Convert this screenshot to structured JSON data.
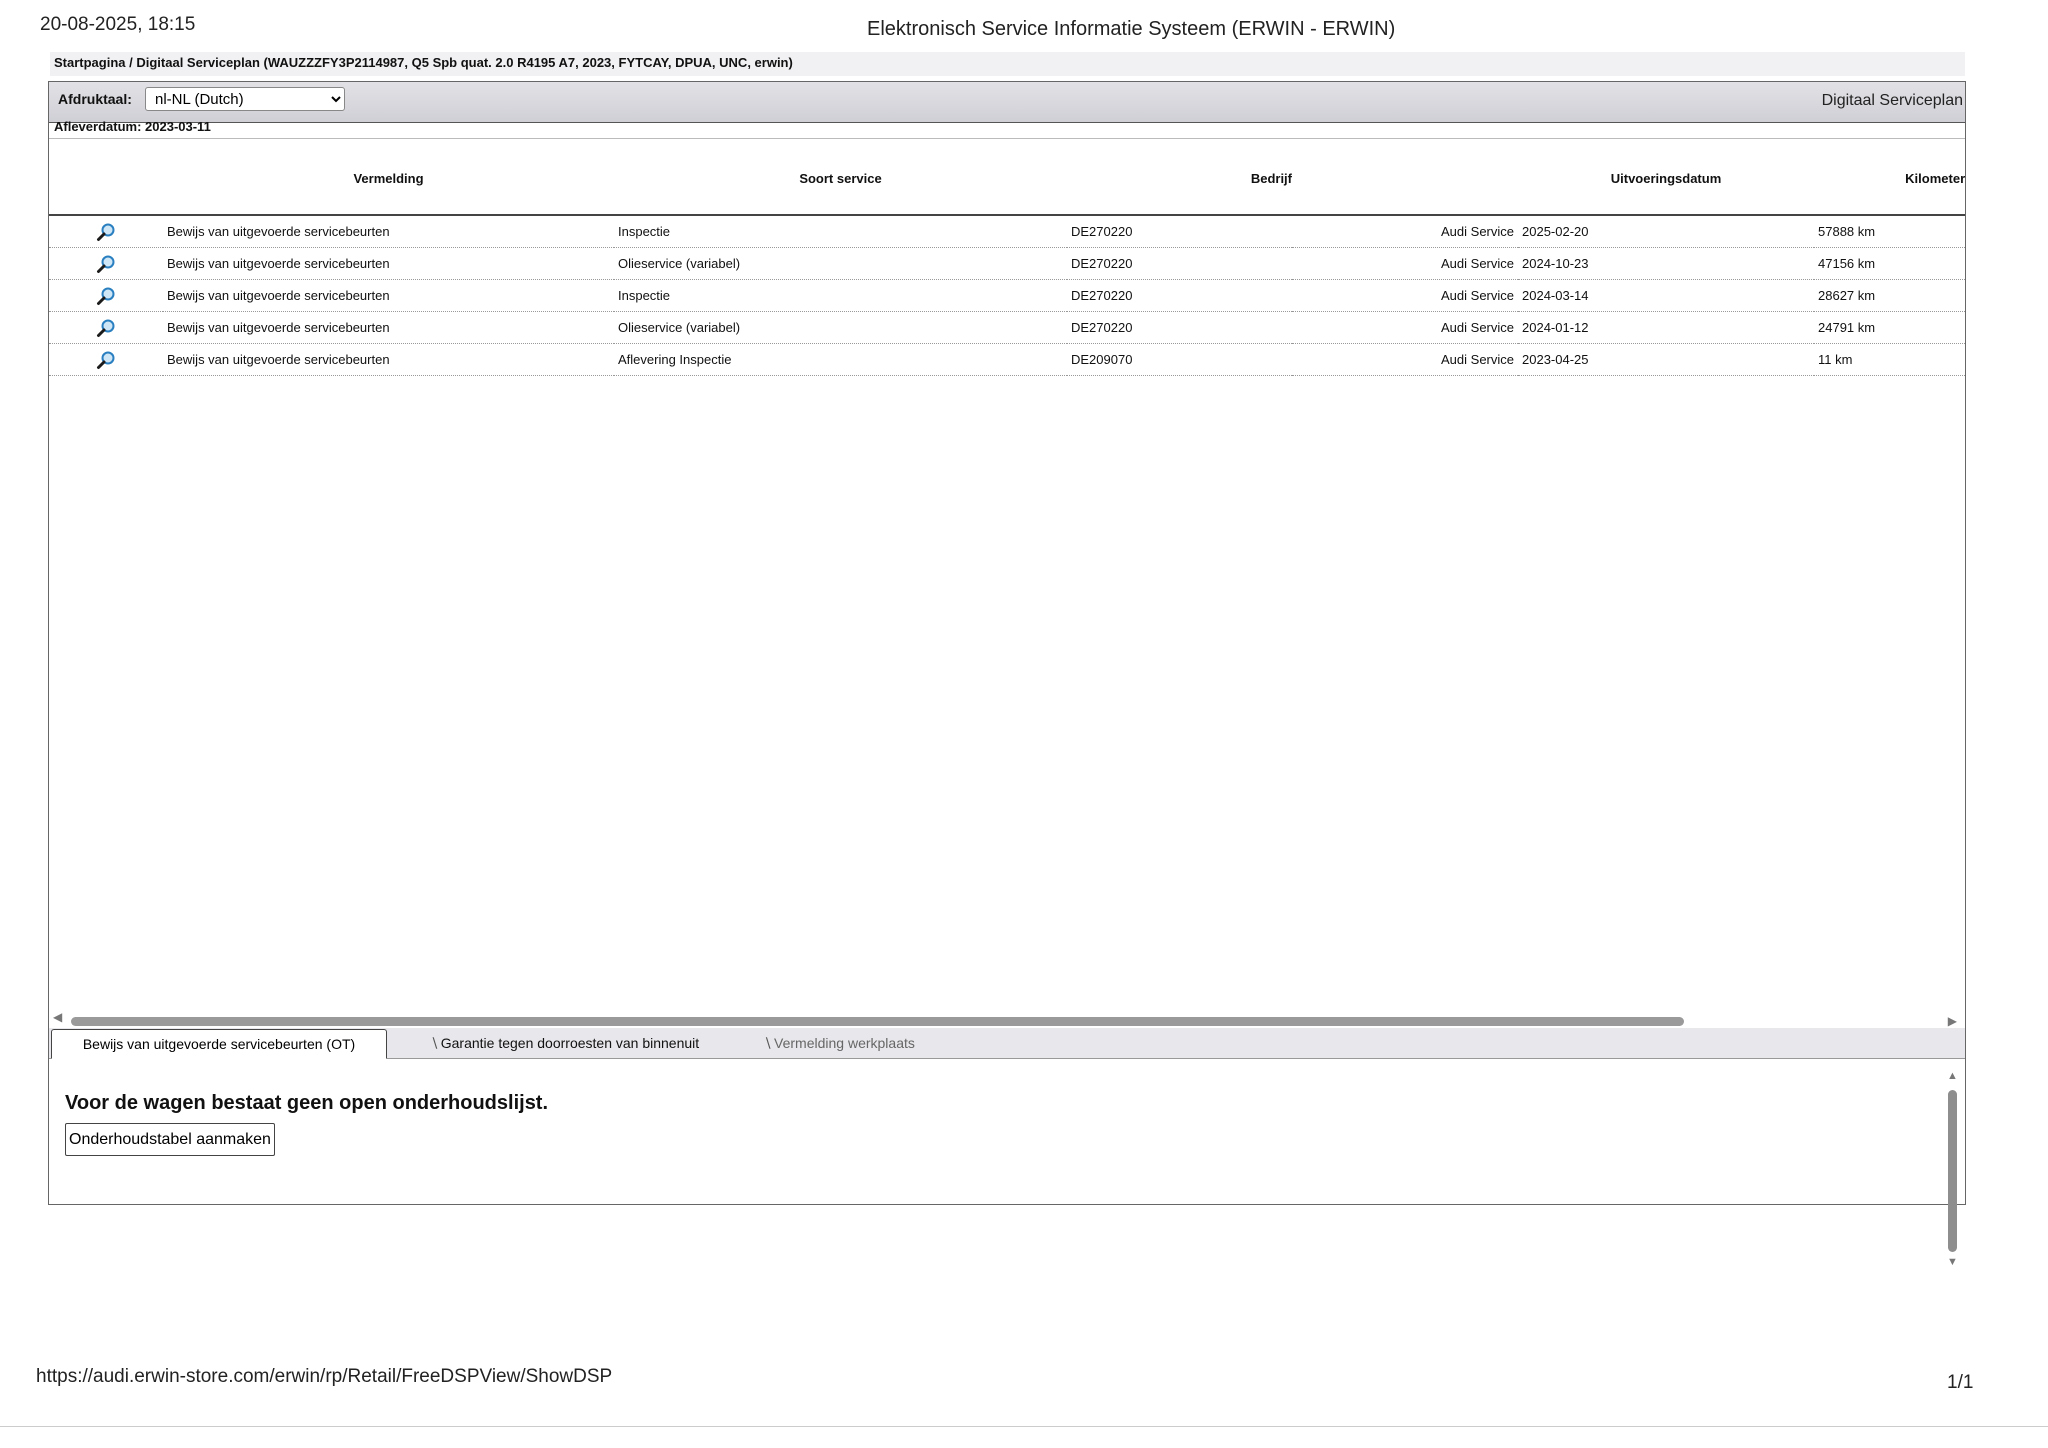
{
  "print_header": {
    "datetime": "20-08-2025, 18:15",
    "title": "Elektronisch Service Informatie Systeem (ERWIN - ERWIN)"
  },
  "breadcrumb": "Startpagina / Digitaal Serviceplan (WAUZZZFY3P2114987, Q5 Spb quat. 2.0 R4195 A7, 2023, FYTCAY, DPUA, UNC, erwin)",
  "toolbar": {
    "print_language_label": "Afdruktaal:",
    "print_language_value": "nl-NL (Dutch)",
    "view_name": "Digitaal Serviceplan"
  },
  "delivery_date": "Afleverdatum: 2023-03-11",
  "table": {
    "columns": [
      "",
      "Vermelding",
      "Soort service",
      "Bedrijf",
      "",
      "Uitvoeringsdatum",
      "Kilometerstand"
    ],
    "rows": [
      {
        "entry": "Bewijs van uitgevoerde servicebeurten",
        "service_type": "Inspectie",
        "dealer_code": "DE270220",
        "company": "Audi Service",
        "date": "2025-02-20",
        "mileage": "57888 km"
      },
      {
        "entry": "Bewijs van uitgevoerde servicebeurten",
        "service_type": "Olieservice (variabel)",
        "dealer_code": "DE270220",
        "company": "Audi Service",
        "date": "2024-10-23",
        "mileage": "47156 km"
      },
      {
        "entry": "Bewijs van uitgevoerde servicebeurten",
        "service_type": "Inspectie",
        "dealer_code": "DE270220",
        "company": "Audi Service",
        "date": "2024-03-14",
        "mileage": "28627 km"
      },
      {
        "entry": "Bewijs van uitgevoerde servicebeurten",
        "service_type": "Olieservice (variabel)",
        "dealer_code": "DE270220",
        "company": "Audi Service",
        "date": "2024-01-12",
        "mileage": "24791 km"
      },
      {
        "entry": "Bewijs van uitgevoerde servicebeurten",
        "service_type": "Aflevering Inspectie",
        "dealer_code": "DE209070",
        "company": "Audi Service",
        "date": "2023-04-25",
        "mileage": "11 km"
      }
    ]
  },
  "tabs": [
    {
      "label": "Bewijs van uitgevoerde servicebeurten (OT)",
      "active": true
    },
    {
      "label": "Garantie tegen doorroesten van binnenuit",
      "active": false
    },
    {
      "label": "Vermelding werkplaats",
      "active": false
    }
  ],
  "maintenance": {
    "message": "Voor de wagen bestaat geen open onderhoudslijst.",
    "button_label": "Onderhoudstabel aanmaken"
  },
  "print_footer": {
    "url": "https://audi.erwin-store.com/erwin/rp/Retail/FreeDSPView/ShowDSP",
    "page": "1/1"
  },
  "icons": {
    "row_view": "magnifier-icon",
    "select": "chevron-down-icon"
  },
  "colors": {
    "toolbar": "#d6d6dc",
    "magnifier": "#2a7fc0"
  }
}
